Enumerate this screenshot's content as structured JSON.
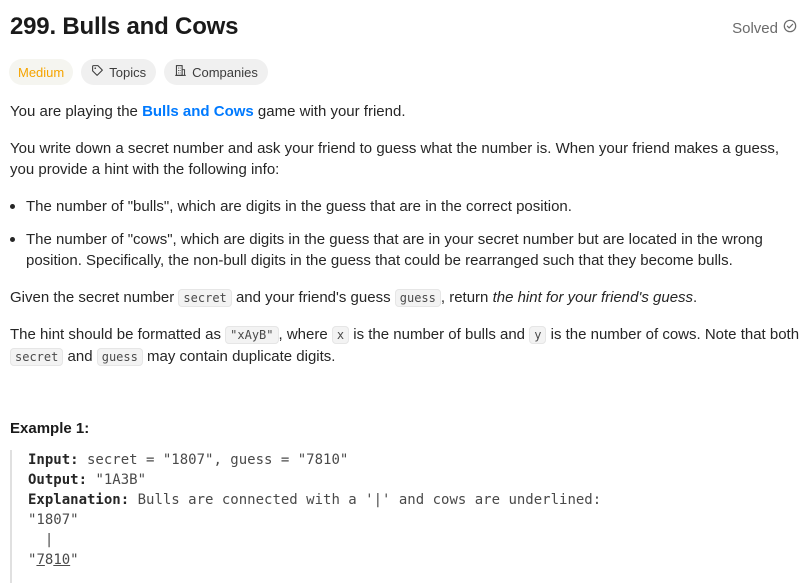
{
  "problem": {
    "title": "299. Bulls and Cows",
    "status": "Solved"
  },
  "tags": {
    "difficulty": "Medium",
    "topics": "Topics",
    "companies": "Companies"
  },
  "description": {
    "p1_a": "You are playing the ",
    "p1_link": "Bulls and Cows",
    "p1_b": " game with your friend.",
    "p2": "You write down a secret number and ask your friend to guess what the number is. When your friend makes a guess, you provide a hint with the following info:",
    "bullet1": "The number of \"bulls\", which are digits in the guess that are in the correct position.",
    "bullet2": "The number of \"cows\", which are digits in the guess that are in your secret number but are located in the wrong position. Specifically, the non-bull digits in the guess that could be rearranged such that they become bulls.",
    "p3_a": "Given the secret number ",
    "p3_code1": "secret",
    "p3_b": " and your friend's guess ",
    "p3_code2": "guess",
    "p3_c": ", return ",
    "p3_em": "the hint for your friend's guess",
    "p3_d": ".",
    "p4_a": "The hint should be formatted as ",
    "p4_code1": "\"xAyB\"",
    "p4_b": ", where ",
    "p4_code2": "x",
    "p4_c": " is the number of bulls and ",
    "p4_code3": "y",
    "p4_d": " is the number of cows. Note that both ",
    "p4_code4": "secret",
    "p4_e": " and ",
    "p4_code5": "guess",
    "p4_f": " may contain duplicate digits."
  },
  "example1": {
    "title": "Example 1:",
    "input_label": "Input:",
    "input_value": " secret = \"1807\", guess = \"7810\"",
    "output_label": "Output:",
    "output_value": " \"1A3B\"",
    "explanation_label": "Explanation:",
    "explanation_value": " Bulls are connected with a '|' and cows are underlined:",
    "line_secret": "\"1807\"",
    "line_bar": "  |",
    "line_guess_open": "\"",
    "line_guess_ul": "7",
    "line_guess_mid": "8",
    "line_guess_ul2": "10",
    "line_guess_close": "\""
  }
}
